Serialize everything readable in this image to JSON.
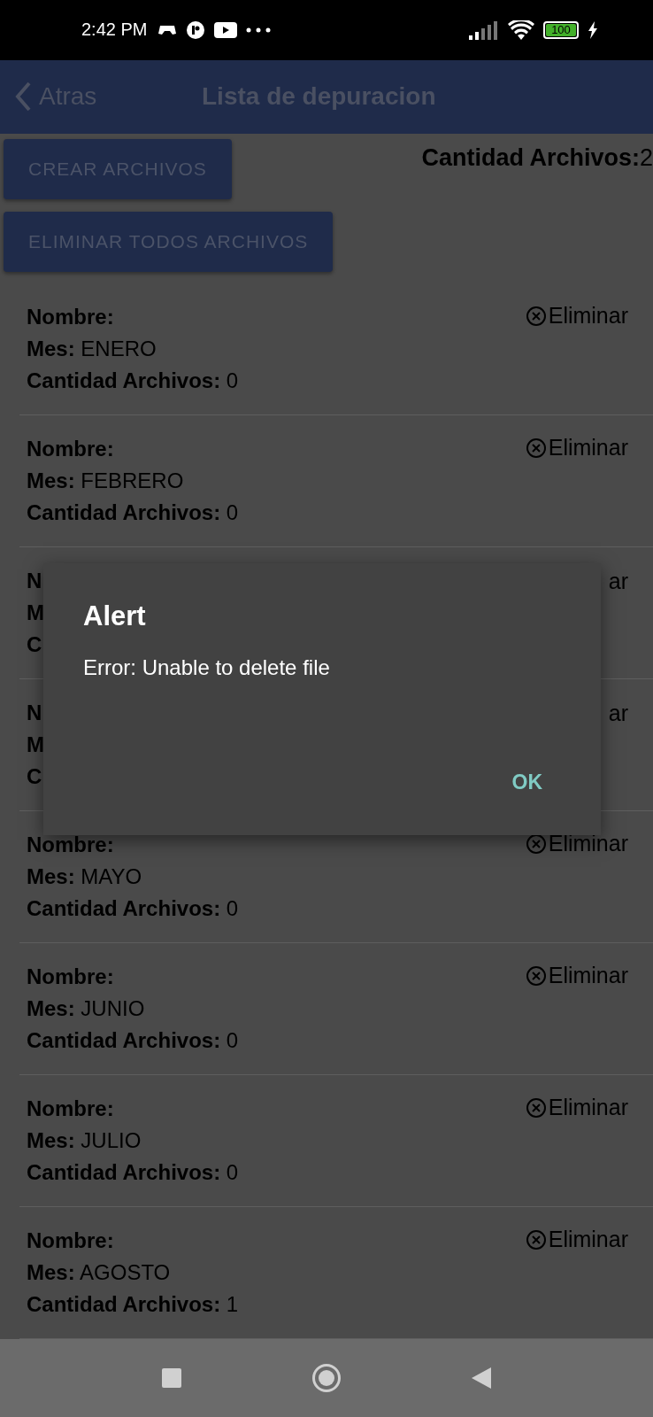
{
  "status_bar": {
    "time": "2:42 PM",
    "battery": "100"
  },
  "header": {
    "back": "Atras",
    "title": "Lista de depuracion"
  },
  "buttons": [
    "CREAR ARCHIVOS",
    "ELIMINAR TODOS ARCHIVOS"
  ],
  "total": {
    "label": "Cantidad Archivos:",
    "value": "2"
  },
  "rows": [
    {
      "kind": "item",
      "fields": [
        {
          "label": "Nombre:"
        },
        {
          "label": "Mes:",
          "value": "ENERO"
        },
        {
          "label": "Cantidad Archivos:",
          "value": "0"
        }
      ],
      "delete": "Eliminar"
    },
    {
      "kind": "item",
      "fields": [
        {
          "label": "Nombre:"
        },
        {
          "label": "Mes:",
          "value": "FEBRERO"
        },
        {
          "label": "Cantidad Archivos:",
          "value": "0"
        }
      ],
      "delete": "Eliminar"
    },
    {
      "kind": "covered",
      "fields": [
        {
          "label": "N"
        },
        {
          "label": "M"
        },
        {
          "label": "C"
        }
      ],
      "delete": "ar"
    },
    {
      "kind": "covered",
      "fields": [
        {
          "label": "N"
        },
        {
          "label": "M"
        },
        {
          "label": "C"
        }
      ],
      "delete": "ar"
    },
    {
      "kind": "item",
      "fields": [
        {
          "label": "Nombre:"
        },
        {
          "label": "Mes:",
          "value": "MAYO"
        },
        {
          "label": "Cantidad Archivos:",
          "value": "0"
        }
      ],
      "delete": "Eliminar"
    },
    {
      "kind": "item",
      "fields": [
        {
          "label": "Nombre:"
        },
        {
          "label": "Mes:",
          "value": "JUNIO"
        },
        {
          "label": "Cantidad Archivos:",
          "value": "0"
        }
      ],
      "delete": "Eliminar"
    },
    {
      "kind": "item",
      "fields": [
        {
          "label": "Nombre:"
        },
        {
          "label": "Mes:",
          "value": "JULIO"
        },
        {
          "label": "Cantidad Archivos:",
          "value": "0"
        }
      ],
      "delete": "Eliminar"
    },
    {
      "kind": "item",
      "fields": [
        {
          "label": "Nombre:"
        },
        {
          "label": "Mes:",
          "value": "AGOSTO"
        },
        {
          "label": "Cantidad Archivos:",
          "value": "1"
        }
      ],
      "delete": "Eliminar"
    }
  ],
  "dialog": {
    "title": "Alert",
    "message": "Error: Unable to delete file",
    "button": "OK"
  }
}
